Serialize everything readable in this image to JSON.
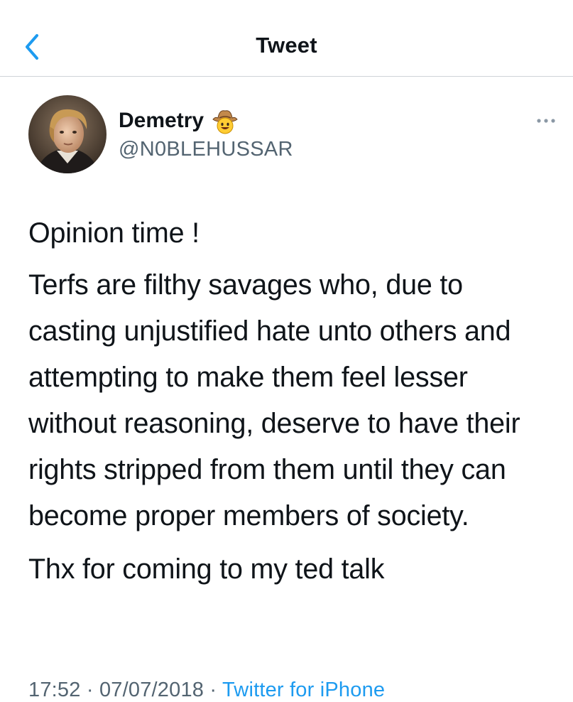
{
  "header": {
    "title": "Tweet",
    "back_icon": "chevron-left-icon",
    "accent_color": "#1d9bf0"
  },
  "author": {
    "display_name": "Demetry",
    "name_emoji": "cowboy-hat-face-emoji",
    "handle": "@N0BLEHUSSAR",
    "avatar": "profile-photo"
  },
  "more_icon": "ellipsis-icon",
  "tweet": {
    "paragraphs": [
      "Opinion time !",
      "Terfs are filthy savages who, due to casting unjustified hate unto others and attempting to make them feel lesser without reasoning, deserve to have their rights stripped from them until they can become proper members of society.",
      "Thx for coming to my ted talk"
    ]
  },
  "meta": {
    "time": "17:52",
    "separator": "·",
    "date": "07/07/2018",
    "source": "Twitter for iPhone"
  }
}
